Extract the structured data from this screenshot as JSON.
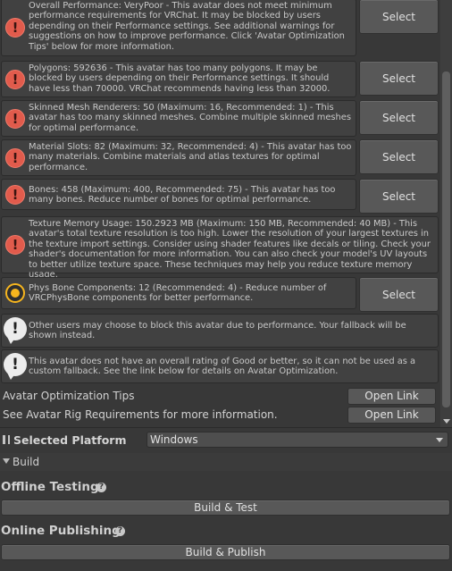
{
  "messages": [
    {
      "type": "error",
      "text": "Overall Performance: VeryPoor - This avatar does not meet minimum performance requirements for VRChat. It may be blocked by users depending on their Performance settings. See additional warnings for suggestions on how to improve performance. Click 'Avatar Optimization Tips' below for more information.",
      "button": "Select"
    },
    {
      "type": "error",
      "text": "Polygons: 592636 - This avatar has too many polygons. It may be blocked by users depending on their Performance settings. It should have less than 70000. VRChat recommends having less than 32000.",
      "button": "Select"
    },
    {
      "type": "error",
      "text": "Skinned Mesh Renderers: 50 (Maximum: 16, Recommended: 1) - This avatar has too many skinned meshes. Combine multiple skinned meshes for optimal performance.",
      "button": "Select"
    },
    {
      "type": "error",
      "text": "Material Slots: 82 (Maximum: 32, Recommended: 4) - This avatar has too many materials. Combine materials and atlas textures for optimal performance.",
      "button": "Select"
    },
    {
      "type": "error",
      "text": "Bones: 458 (Maximum: 400, Recommended: 75) - This avatar has too many bones. Reduce number of bones for optimal performance.",
      "button": "Select"
    },
    {
      "type": "error",
      "text": "Texture Memory Usage: 150.2923 MB (Maximum: 150 MB, Recommended: 40 MB) - This avatar's total texture resolution is too high. Lower the resolution of your largest textures in the texture import settings. Consider using shader features like decals or tiling. Check your shader's documentation for more information. You can also check your model's UV layouts to better utilize texture space. These techniques may help you reduce texture memory usage."
    },
    {
      "type": "warning",
      "text": "Phys Bone Components: 12 (Recommended: 4) - Reduce number of VRCPhysBone components for better performance.",
      "button": "Select"
    },
    {
      "type": "info",
      "text": "Other users may choose to block this avatar due to performance. Your fallback will be shown instead."
    },
    {
      "type": "info",
      "text": "This avatar does not have an overall rating of Good or better, so it can not be used as a custom fallback. See the link below for details on Avatar Optimization."
    }
  ],
  "links": [
    {
      "label": "Avatar Optimization Tips",
      "button": "Open Link"
    },
    {
      "label": "See Avatar Rig Requirements for more information.",
      "button": "Open Link"
    }
  ],
  "platform": {
    "label": "Selected Platform",
    "value": "Windows"
  },
  "build": {
    "header": "Build",
    "offline_title": "Offline Testing",
    "offline_button": "Build & Test",
    "online_title": "Online Publishing",
    "online_button": "Build & Publish",
    "help_glyph": "?"
  },
  "icons": {
    "error": "!",
    "info": "!"
  },
  "colors": {
    "error": "#e15b4c",
    "warning": "#f6b51e",
    "background": "#383838"
  }
}
